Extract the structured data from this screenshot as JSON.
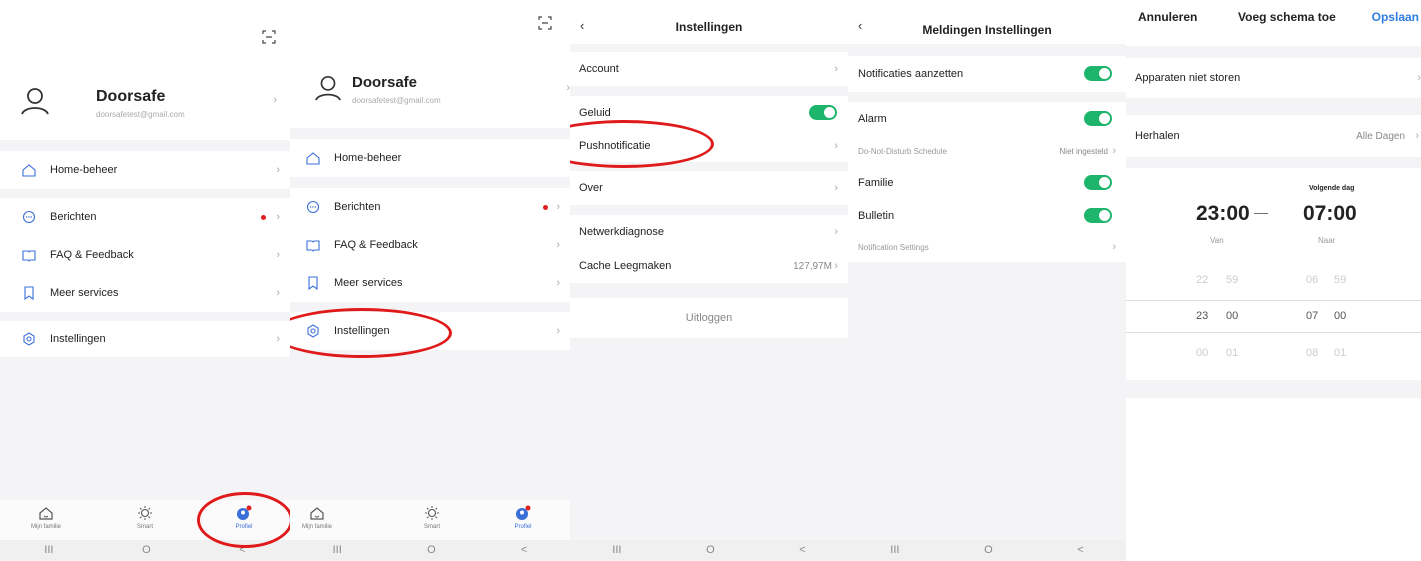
{
  "profile": {
    "name": "Doorsafe",
    "email": "doorsafetest@gmail.com",
    "scan_icon": "scan-icon",
    "menu": [
      {
        "label": "Home-beheer",
        "icon": "home-icon"
      },
      {
        "label": "Berichten",
        "icon": "message-icon"
      },
      {
        "label": "FAQ & Feedback",
        "icon": "book-icon"
      },
      {
        "label": "Meer services",
        "icon": "bookmark-icon"
      },
      {
        "label": "Instellingen",
        "icon": "settings-icon"
      }
    ],
    "nav": [
      {
        "label": "Mijn familie",
        "icon": "house-icon"
      },
      {
        "label": "Smart",
        "icon": "sun-icon"
      },
      {
        "label": "Profiel",
        "icon": "profile-icon"
      }
    ],
    "sys": [
      "III",
      "O",
      "<"
    ]
  },
  "settings": {
    "title": "Instellingen",
    "account": "Account",
    "sound": "Geluid",
    "push": "Pushnotificatie",
    "about": "Over",
    "network": "Netwerkdiagnose",
    "cache": "Cache Leegmaken",
    "cache_value": "127,97M",
    "logout": "Uitloggen"
  },
  "notifications": {
    "title": "Meldingen Instellingen",
    "enable": "Notificaties aanzetten",
    "alarm": "Alarm",
    "dnd": "Do-Not-Disturb Schedule",
    "dnd_value": "Niet ingesteld",
    "family": "Familie",
    "bulletin": "Bulletin",
    "settings": "Notification Settings"
  },
  "schedule": {
    "cancel": "Annuleren",
    "title": "Voeg schema toe",
    "save": "Opslaan",
    "devices": "Apparaten niet storen",
    "repeat": "Herhalen",
    "repeat_value": "Alle Dagen",
    "next_day": "Volgende dag",
    "from_time": "23:00",
    "to_time": "07:00",
    "from_label": "Van",
    "to_label": "Naar",
    "dash": "—",
    "picker_rows": [
      {
        "h1": "22",
        "m1": "59",
        "h2": "06",
        "m2": "59"
      },
      {
        "h1": "23",
        "m1": "00",
        "h2": "07",
        "m2": "00"
      },
      {
        "h1": "00",
        "m1": "01",
        "h2": "08",
        "m2": "01"
      }
    ]
  },
  "colors": {
    "toggle": "#1db46b",
    "highlight": "#e01a1a",
    "accent": "#2f7de1",
    "badge": "#e02020"
  }
}
